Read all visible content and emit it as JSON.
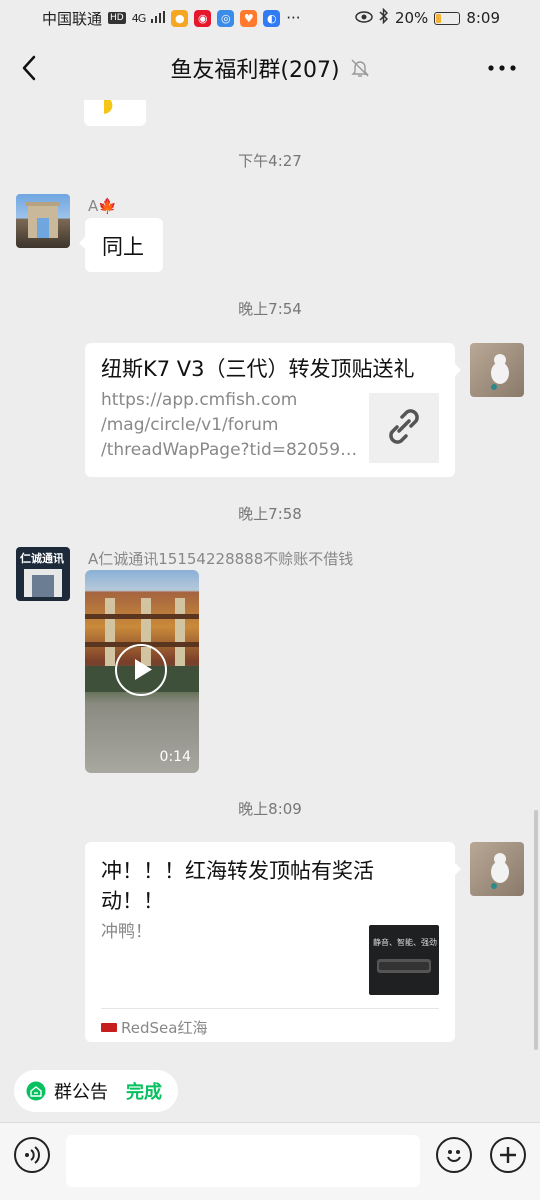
{
  "status": {
    "carrier": "中国联通",
    "hd": "HD",
    "net": "4G",
    "battery": "20%",
    "time": "8:09",
    "battery_level": 0.2
  },
  "header": {
    "title": "鱼友福利群(207)",
    "back_icon": "chevron-left-icon",
    "mute_icon": "bell-off-icon",
    "more_icon": "more-dots-icon"
  },
  "messages": {
    "t1": "下午4:27",
    "m1": {
      "sender": "A🍁",
      "text": "同上"
    },
    "t2": "晚上7:54",
    "m2": {
      "title": "纽斯K7 V3（三代）转发顶贴送礼",
      "url_lines": [
        "https://app.cmfish.com",
        "/mag/circle/v1/forum",
        "/threadWapPage?tid=82059…"
      ]
    },
    "t3": "晚上7:58",
    "m3": {
      "sender": "A仁诚通讯15154228888不赊账不借钱",
      "avatar_text": "仁诚通讯",
      "duration": "0:14"
    },
    "t4": "晚上8:09",
    "m4": {
      "title": "冲！！！红海转发顶帖有奖活动！！",
      "desc": "冲鸭！",
      "source": "RedSea红海",
      "thumb_text": "静音、智能、强劲"
    }
  },
  "notice": {
    "label": "群公告",
    "done": "完成",
    "accent": "#07c160"
  },
  "input": {
    "placeholder": ""
  }
}
